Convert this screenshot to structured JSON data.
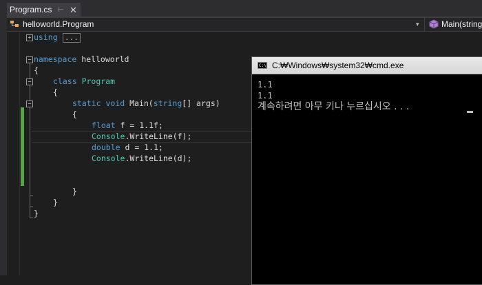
{
  "tab": {
    "title": "Program.cs",
    "pin_icon": "pin-icon",
    "close_icon": "close-icon"
  },
  "nav": {
    "left_text": "helloworld.Program",
    "right_text": "Main(string[]",
    "dropdown_glyph": "▾"
  },
  "code": {
    "lines": [
      "using",
      "namespace helloworld",
      "{",
      "class Program",
      "{",
      "static void Main(string[] args)",
      "{",
      "float f = 1.1f;",
      "Console.WriteLine(f);",
      "double d = 1.1;",
      "Console.WriteLine(d);",
      "}",
      "}",
      "}"
    ],
    "collapsed_marker": "...",
    "colors": {
      "keyword": "#569cd6",
      "type": "#4ec9b0",
      "text": "#dcdcdc",
      "change_bar": "#57a64a"
    }
  },
  "cmd": {
    "title": "C:₩Windows₩system32₩cmd.exe",
    "output": [
      "1.1",
      "1.1",
      "계속하려면 아무 키나 누르십시오 . . ."
    ]
  }
}
